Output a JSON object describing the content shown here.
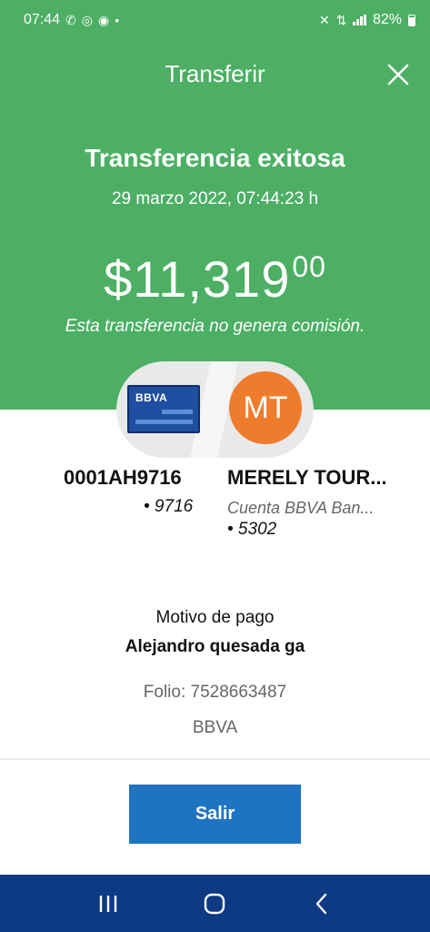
{
  "status_bar": {
    "time": "07:44",
    "battery": "82%",
    "left_icons": [
      "phone-icon",
      "whatsapp-icon",
      "messenger-icon",
      "dot-icon"
    ],
    "right_icons": [
      "mute-icon",
      "data-icon",
      "signal-icon",
      "battery-icon"
    ]
  },
  "header": {
    "title": "Transferir",
    "success_title": "Transferencia exitosa",
    "datetime": "29 marzo 2022, 07:44:23 h",
    "amount_main": "$11,319",
    "amount_cents": "00",
    "commission_note": "Esta transferencia no genera comisión."
  },
  "origin": {
    "card_brand": "BBVA",
    "account": "0001AH9716",
    "last_digits": "• 9716"
  },
  "destination": {
    "initials": "MT",
    "name": "MERELY TOUR...",
    "bank": "Cuenta BBVA Ban...",
    "last_digits": "• 5302"
  },
  "payment": {
    "reason_label": "Motivo de pago",
    "reason_value": "Alejandro quesada ga",
    "folio": "Folio: 7528663487",
    "bank": "BBVA"
  },
  "actions": {
    "exit_label": "Salir"
  },
  "colors": {
    "header_green": "#4caf64",
    "avatar_orange": "#ef7b2c",
    "button_blue": "#1f74c2",
    "nav_blue": "#0e3a84",
    "card_blue": "#1f4fa0"
  }
}
